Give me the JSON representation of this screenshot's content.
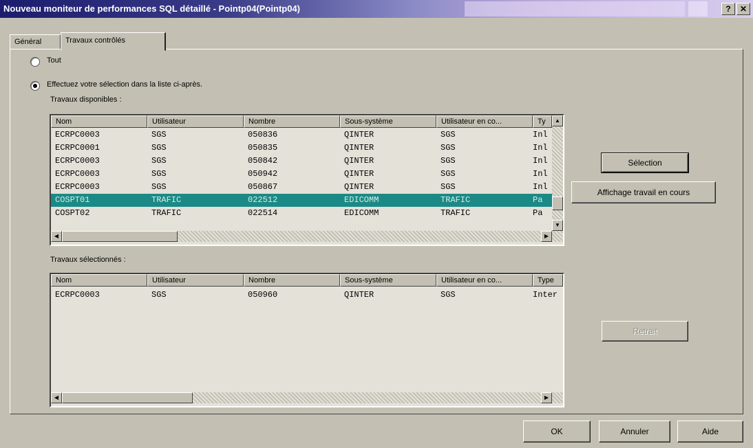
{
  "window": {
    "title": "Nouveau moniteur de performances SQL détaillé - Pointp04(Pointp04)",
    "help_glyph": "?",
    "close_glyph": "✕"
  },
  "tabs": [
    "Général",
    "Travaux contrôlés"
  ],
  "active_tab": "Travaux contrôlés",
  "radio": {
    "all_label": "Tout",
    "select_label": "Effectuez votre sélection dans la liste ci-après.",
    "selected": "select"
  },
  "available": {
    "label": "Travaux disponibles :",
    "columns": [
      "Nom",
      "Utilisateur",
      "Nombre",
      "Sous-système",
      "Utilisateur en co...",
      "Ty"
    ],
    "rows": [
      [
        "ECRPC0003",
        "SGS",
        "050836",
        "QINTER",
        "SGS",
        "Inl"
      ],
      [
        "ECRPC0001",
        "SGS",
        "050835",
        "QINTER",
        "SGS",
        "Inl"
      ],
      [
        "ECRPC0003",
        "SGS",
        "050842",
        "QINTER",
        "SGS",
        "Inl"
      ],
      [
        "ECRPC0003",
        "SGS",
        "050942",
        "QINTER",
        "SGS",
        "Inl"
      ],
      [
        "ECRPC0003",
        "SGS",
        "050867",
        "QINTER",
        "SGS",
        "Inl"
      ],
      [
        "COSPT01",
        "TRAFIC",
        "022512",
        "EDICOMM",
        "TRAFIC",
        "Pa"
      ],
      [
        "COSPT02",
        "TRAFIC",
        "022514",
        "EDICOMM",
        "TRAFIC",
        "Pa"
      ]
    ],
    "selected_row": 5
  },
  "selected_jobs": {
    "label": "Travaux sélectionnés :",
    "columns": [
      "Nom",
      "Utilisateur",
      "Nombre",
      "Sous-système",
      "Utilisateur en co...",
      "Type"
    ],
    "rows": [
      [
        "ECRPC0003",
        "SGS",
        "050960",
        "QINTER",
        "SGS",
        "Inter"
      ]
    ]
  },
  "buttons": {
    "selection": "Sélection",
    "show_current": "Affichage travail en cours",
    "remove": "Retrait",
    "ok": "OK",
    "cancel": "Annuler",
    "help": "Aide"
  },
  "colors": {
    "face": "#c3c0b3",
    "list_bg": "#e3e1d8",
    "selection": "#1b8a86",
    "title_start": "#1c1c6e"
  }
}
